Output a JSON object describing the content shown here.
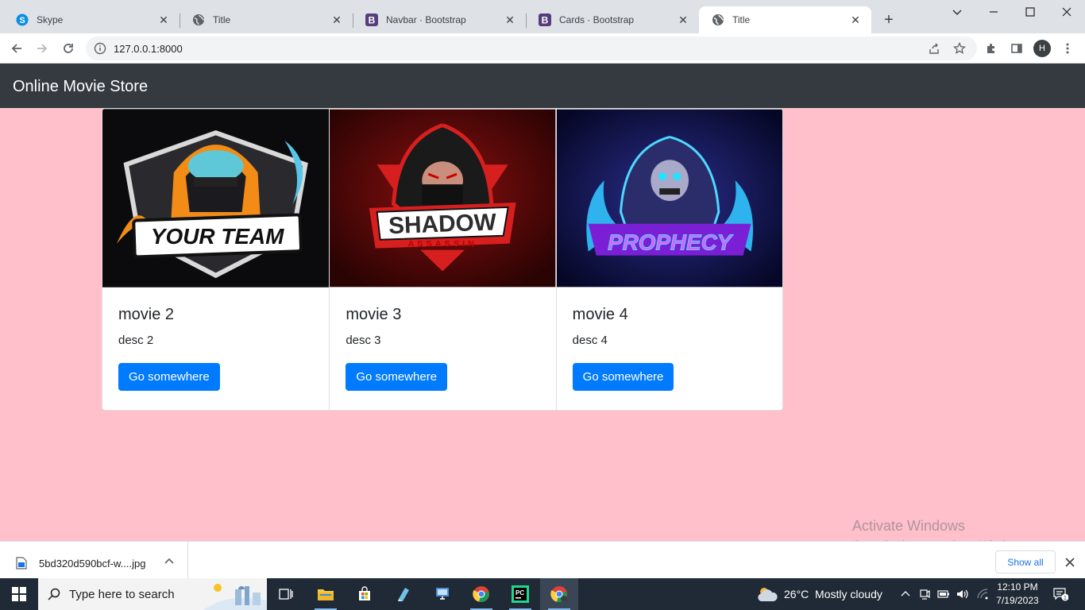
{
  "browser": {
    "tabs": [
      {
        "label": "Skype",
        "icon": "skype-icon",
        "active": false
      },
      {
        "label": "Title",
        "icon": "globe-icon",
        "active": false
      },
      {
        "label": "Navbar · Bootstrap",
        "icon": "bootstrap-icon",
        "active": false
      },
      {
        "label": "Cards · Bootstrap",
        "icon": "bootstrap-icon",
        "active": false
      },
      {
        "label": "Title",
        "icon": "globe-icon",
        "active": true
      }
    ],
    "url": "127.0.0.1:8000",
    "profile_initial": "H"
  },
  "page": {
    "brand": "Online Movie Store",
    "background": "#ffc0cb",
    "navbar_color": "#343a40",
    "button_color": "#007bff",
    "cards": [
      {
        "title": "movie 2",
        "desc": "desc 2",
        "button": "Go somewhere",
        "image_text": "YOUR TEAM",
        "image_icon": "hooded-mascot-logo-icon"
      },
      {
        "title": "movie 3",
        "desc": "desc 3",
        "button": "Go somewhere",
        "image_text": "SHADOW",
        "image_subtext": "ASSASSIN",
        "image_icon": "assassin-mascot-logo-icon"
      },
      {
        "title": "movie 4",
        "desc": "desc 4",
        "button": "Go somewhere",
        "image_text": "PROPHECY",
        "image_icon": "reaper-mascot-logo-icon"
      }
    ]
  },
  "watermark": {
    "line1": "Activate Windows",
    "line2": "Go to Settings to activate Windows."
  },
  "downloads": {
    "filename": "5bd320d590bcf-w....jpg",
    "show_all": "Show all"
  },
  "taskbar": {
    "search_placeholder": "Type here to search",
    "weather": "26°C  Mostly cloudy",
    "time": "12:10 PM",
    "date": "7/19/2023",
    "notification_count": "1"
  }
}
